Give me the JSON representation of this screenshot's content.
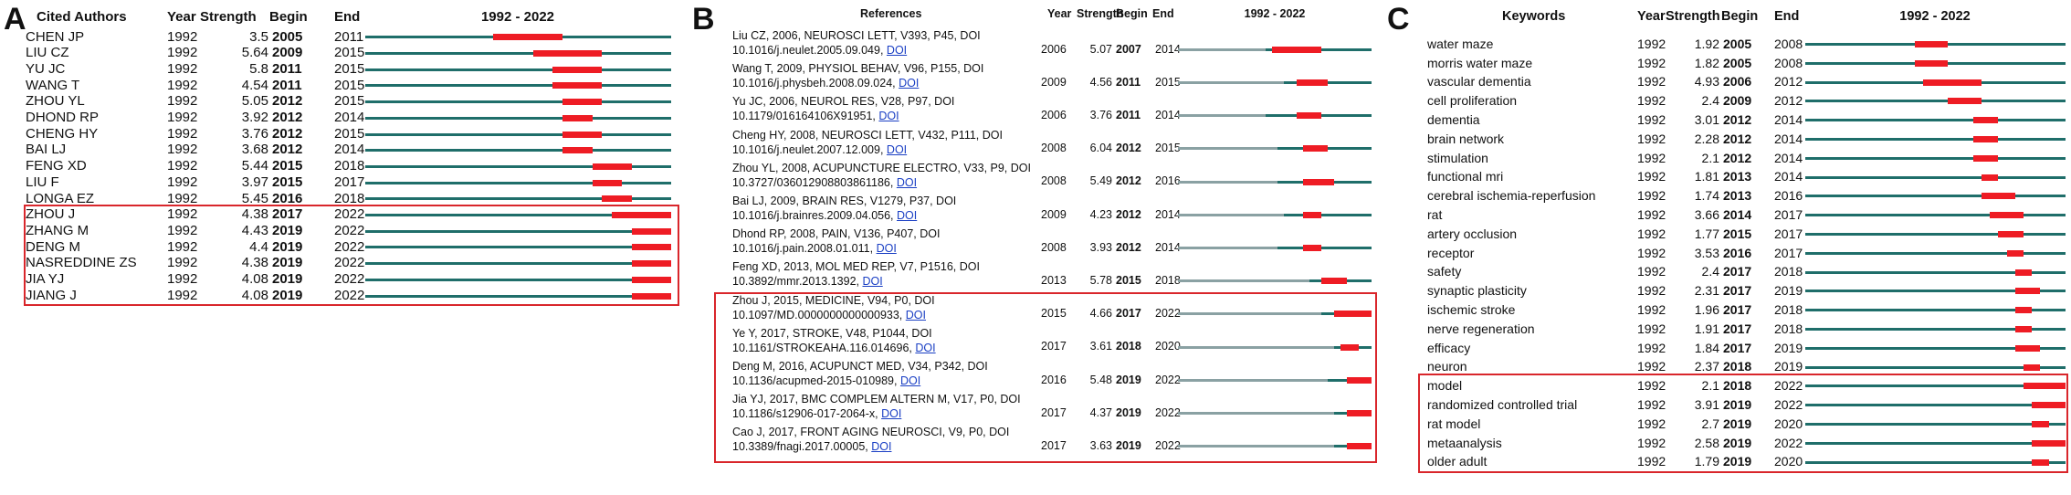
{
  "colors": {
    "baseline": "#1f6e6a",
    "before": "#8aa1a3",
    "burst": "#ee1c24",
    "highlight": "#d9262b"
  },
  "chart_data": [
    {
      "panel": "A",
      "type": "table",
      "headers": {
        "name": "Cited Authors",
        "year": "Year",
        "strength": "Strength",
        "begin": "Begin",
        "end": "End",
        "range": "1992 - 2022"
      },
      "range": [
        1992,
        2022
      ],
      "highlight_from": 11,
      "rows": [
        {
          "name": "CHEN JP",
          "year": "1992",
          "strength": "3.5",
          "begin": "2005",
          "end": "2011"
        },
        {
          "name": "LIU CZ",
          "year": "1992",
          "strength": "5.64",
          "begin": "2009",
          "end": "2015"
        },
        {
          "name": "YU JC",
          "year": "1992",
          "strength": "5.8",
          "begin": "2011",
          "end": "2015"
        },
        {
          "name": "WANG T",
          "year": "1992",
          "strength": "4.54",
          "begin": "2011",
          "end": "2015"
        },
        {
          "name": "ZHOU YL",
          "year": "1992",
          "strength": "5.05",
          "begin": "2012",
          "end": "2015"
        },
        {
          "name": "DHOND RP",
          "year": "1992",
          "strength": "3.92",
          "begin": "2012",
          "end": "2014"
        },
        {
          "name": "CHENG HY",
          "year": "1992",
          "strength": "3.76",
          "begin": "2012",
          "end": "2015"
        },
        {
          "name": "BAI LJ",
          "year": "1992",
          "strength": "3.68",
          "begin": "2012",
          "end": "2014"
        },
        {
          "name": "FENG XD",
          "year": "1992",
          "strength": "5.44",
          "begin": "2015",
          "end": "2018"
        },
        {
          "name": "LIU F",
          "year": "1992",
          "strength": "3.97",
          "begin": "2015",
          "end": "2017"
        },
        {
          "name": "LONGA EZ",
          "year": "1992",
          "strength": "5.45",
          "begin": "2016",
          "end": "2018"
        },
        {
          "name": "ZHOU J",
          "year": "1992",
          "strength": "4.38",
          "begin": "2017",
          "end": "2022"
        },
        {
          "name": "ZHANG M",
          "year": "1992",
          "strength": "4.43",
          "begin": "2019",
          "end": "2022"
        },
        {
          "name": "DENG M",
          "year": "1992",
          "strength": "4.4",
          "begin": "2019",
          "end": "2022"
        },
        {
          "name": "NASREDDINE ZS",
          "year": "1992",
          "strength": "4.38",
          "begin": "2019",
          "end": "2022"
        },
        {
          "name": "JIA YJ",
          "year": "1992",
          "strength": "4.08",
          "begin": "2019",
          "end": "2022"
        },
        {
          "name": "JIANG J",
          "year": "1992",
          "strength": "4.08",
          "begin": "2019",
          "end": "2022"
        }
      ]
    },
    {
      "panel": "B",
      "type": "table",
      "headers": {
        "name": "References",
        "year": "Year",
        "strength": "Strength",
        "begin": "Begin",
        "end": "End",
        "range": "1992 - 2022"
      },
      "range": [
        1992,
        2022
      ],
      "highlight_from": 8,
      "rows": [
        {
          "ref": "Liu CZ, 2006, NEUROSCI LETT, V393, P45, DOI",
          "doi": "10.1016/j.neulet.2005.09.049,",
          "link": "DOI",
          "year": "2006",
          "strength": "5.07",
          "begin": "2007",
          "end": "2014"
        },
        {
          "ref": "Wang T, 2009, PHYSIOL BEHAV, V96, P155, DOI",
          "doi": "10.1016/j.physbeh.2008.09.024,",
          "link": "DOI",
          "year": "2009",
          "strength": "4.56",
          "begin": "2011",
          "end": "2015"
        },
        {
          "ref": "Yu JC, 2006, NEUROL RES, V28, P97, DOI",
          "doi": "10.1179/016164106X91951,",
          "link": "DOI",
          "year": "2006",
          "strength": "3.76",
          "begin": "2011",
          "end": "2014"
        },
        {
          "ref": "Cheng HY, 2008, NEUROSCI LETT, V432, P111, DOI",
          "doi": "10.1016/j.neulet.2007.12.009,",
          "link": "DOI",
          "year": "2008",
          "strength": "6.04",
          "begin": "2012",
          "end": "2015"
        },
        {
          "ref": "Zhou YL, 2008, ACUPUNCTURE ELECTRO, V33, P9, DOI",
          "doi": "10.3727/036012908803861186,",
          "link": "DOI",
          "year": "2008",
          "strength": "5.49",
          "begin": "2012",
          "end": "2016"
        },
        {
          "ref": "Bai LJ, 2009, BRAIN RES, V1279, P37, DOI",
          "doi": "10.1016/j.brainres.2009.04.056,",
          "link": "DOI",
          "year": "2009",
          "strength": "4.23",
          "begin": "2012",
          "end": "2014"
        },
        {
          "ref": "Dhond RP, 2008, PAIN, V136, P407, DOI",
          "doi": "10.1016/j.pain.2008.01.011,",
          "link": "DOI",
          "year": "2008",
          "strength": "3.93",
          "begin": "2012",
          "end": "2014"
        },
        {
          "ref": "Feng XD, 2013, MOL MED REP, V7, P1516, DOI",
          "doi": "10.3892/mmr.2013.1392,",
          "link": "DOI",
          "year": "2013",
          "strength": "5.78",
          "begin": "2015",
          "end": "2018"
        },
        {
          "ref": "Zhou J, 2015, MEDICINE, V94, P0, DOI",
          "doi": "10.1097/MD.0000000000000933,",
          "link": "DOI",
          "year": "2015",
          "strength": "4.66",
          "begin": "2017",
          "end": "2022"
        },
        {
          "ref": "Ye Y, 2017, STROKE, V48, P1044, DOI",
          "doi": "10.1161/STROKEAHA.116.014696,",
          "link": "DOI",
          "year": "2017",
          "strength": "3.61",
          "begin": "2018",
          "end": "2020"
        },
        {
          "ref": "Deng M, 2016, ACUPUNCT MED, V34, P342, DOI",
          "doi": "10.1136/acupmed-2015-010989,",
          "link": "DOI",
          "year": "2016",
          "strength": "5.48",
          "begin": "2019",
          "end": "2022"
        },
        {
          "ref": "Jia YJ, 2017, BMC COMPLEM ALTERN M, V17, P0, DOI",
          "doi": "10.1186/s12906-017-2064-x,",
          "link": "DOI",
          "year": "2017",
          "strength": "4.37",
          "begin": "2019",
          "end": "2022"
        },
        {
          "ref": "Cao J, 2017, FRONT AGING NEUROSCI, V9, P0, DOI",
          "doi": "10.3389/fnagi.2017.00005,",
          "link": "DOI",
          "year": "2017",
          "strength": "3.63",
          "begin": "2019",
          "end": "2022"
        }
      ]
    },
    {
      "panel": "C",
      "type": "table",
      "headers": {
        "name": "Keywords",
        "year": "Year",
        "strength": "Strength",
        "begin": "Begin",
        "end": "End",
        "range": "1992 - 2022"
      },
      "range": [
        1992,
        2022
      ],
      "highlight_from": 18,
      "rows": [
        {
          "name": "water maze",
          "year": "1992",
          "strength": "1.92",
          "begin": "2005",
          "end": "2008"
        },
        {
          "name": "morris water maze",
          "year": "1992",
          "strength": "1.82",
          "begin": "2005",
          "end": "2008"
        },
        {
          "name": "vascular dementia",
          "year": "1992",
          "strength": "4.93",
          "begin": "2006",
          "end": "2012"
        },
        {
          "name": "cell proliferation",
          "year": "1992",
          "strength": "2.4",
          "begin": "2009",
          "end": "2012"
        },
        {
          "name": "dementia",
          "year": "1992",
          "strength": "3.01",
          "begin": "2012",
          "end": "2014"
        },
        {
          "name": "brain network",
          "year": "1992",
          "strength": "2.28",
          "begin": "2012",
          "end": "2014"
        },
        {
          "name": "stimulation",
          "year": "1992",
          "strength": "2.1",
          "begin": "2012",
          "end": "2014"
        },
        {
          "name": "functional mri",
          "year": "1992",
          "strength": "1.81",
          "begin": "2013",
          "end": "2014"
        },
        {
          "name": "cerebral ischemia-reperfusion",
          "year": "1992",
          "strength": "1.74",
          "begin": "2013",
          "end": "2016"
        },
        {
          "name": "rat",
          "year": "1992",
          "strength": "3.66",
          "begin": "2014",
          "end": "2017"
        },
        {
          "name": "artery occlusion",
          "year": "1992",
          "strength": "1.77",
          "begin": "2015",
          "end": "2017"
        },
        {
          "name": "receptor",
          "year": "1992",
          "strength": "3.53",
          "begin": "2016",
          "end": "2017"
        },
        {
          "name": "safety",
          "year": "1992",
          "strength": "2.4",
          "begin": "2017",
          "end": "2018"
        },
        {
          "name": "synaptic plasticity",
          "year": "1992",
          "strength": "2.31",
          "begin": "2017",
          "end": "2019"
        },
        {
          "name": "ischemic stroke",
          "year": "1992",
          "strength": "1.96",
          "begin": "2017",
          "end": "2018"
        },
        {
          "name": "nerve regeneration",
          "year": "1992",
          "strength": "1.91",
          "begin": "2017",
          "end": "2018"
        },
        {
          "name": "efficacy",
          "year": "1992",
          "strength": "1.84",
          "begin": "2017",
          "end": "2019"
        },
        {
          "name": "neuron",
          "year": "1992",
          "strength": "2.37",
          "begin": "2018",
          "end": "2019"
        },
        {
          "name": "model",
          "year": "1992",
          "strength": "2.1",
          "begin": "2018",
          "end": "2022"
        },
        {
          "name": "randomized controlled trial",
          "year": "1992",
          "strength": "3.91",
          "begin": "2019",
          "end": "2022"
        },
        {
          "name": "rat model",
          "year": "1992",
          "strength": "2.7",
          "begin": "2019",
          "end": "2020"
        },
        {
          "name": "metaanalysis",
          "year": "1992",
          "strength": "2.58",
          "begin": "2019",
          "end": "2022"
        },
        {
          "name": "older adult",
          "year": "1992",
          "strength": "1.79",
          "begin": "2019",
          "end": "2020"
        }
      ]
    }
  ]
}
